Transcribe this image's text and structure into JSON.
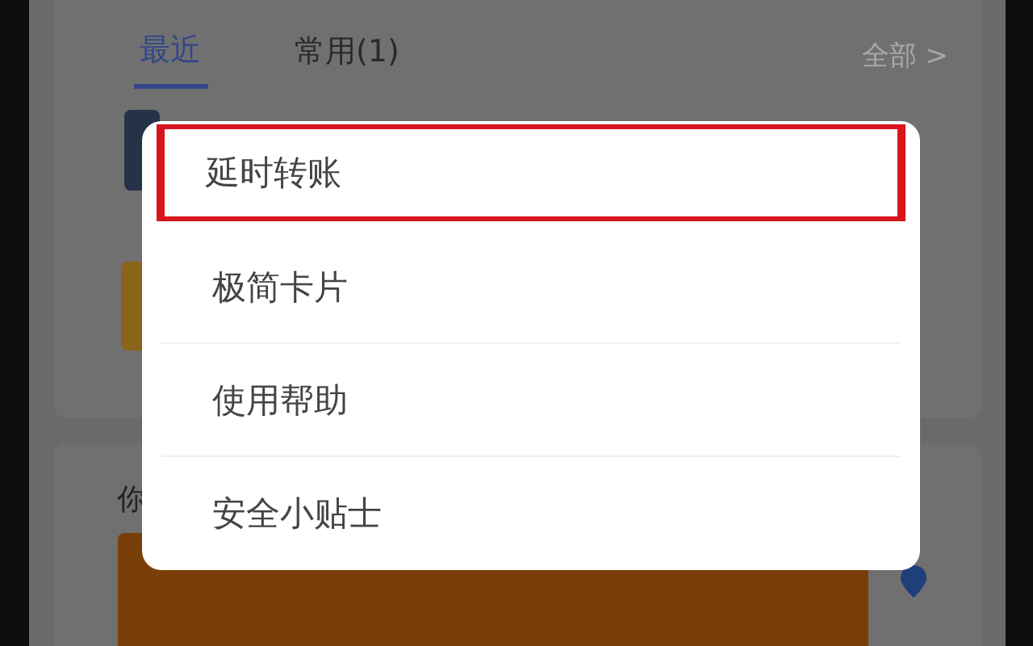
{
  "tabs": [
    {
      "label": "最近",
      "selected": true
    },
    {
      "label": "常用(1)",
      "selected": false
    }
  ],
  "all_link": "全部 >",
  "section_label": "你",
  "menu": {
    "items": [
      {
        "label": "延时转账",
        "highlighted": true
      },
      {
        "label": "极简卡片",
        "highlighted": false
      },
      {
        "label": "使用帮助",
        "highlighted": false
      },
      {
        "label": "安全小贴士",
        "highlighted": false
      }
    ]
  }
}
